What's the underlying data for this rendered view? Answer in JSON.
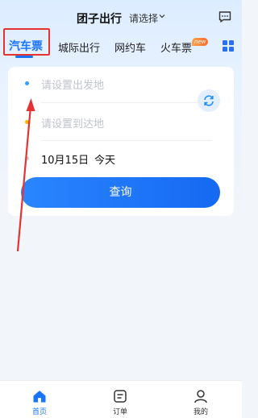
{
  "header": {
    "title": "团子出行",
    "region_select": "请选择"
  },
  "tabs": [
    {
      "label": "汽车票",
      "active": true
    },
    {
      "label": "城际出行",
      "active": false
    },
    {
      "label": "网约车",
      "active": false
    },
    {
      "label": "火车票",
      "active": false,
      "badge": "new"
    }
  ],
  "booking": {
    "origin_placeholder": "请设置出发地",
    "destination_placeholder": "请设置到达地",
    "date": "10月15日",
    "day_label": "今天",
    "search_label": "查询"
  },
  "bottom_nav": [
    {
      "label": "首页",
      "icon": "home-icon",
      "active": true
    },
    {
      "label": "订单",
      "icon": "order-icon",
      "active": false
    },
    {
      "label": "我的",
      "icon": "profile-icon",
      "active": false
    }
  ],
  "colors": {
    "accent": "#1a74ff",
    "annotation": "#e63232"
  }
}
